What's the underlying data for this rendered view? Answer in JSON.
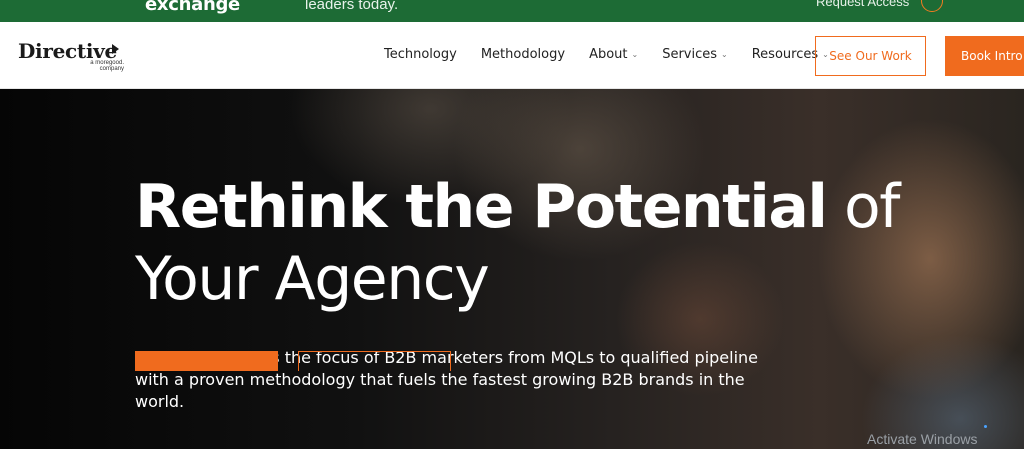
{
  "banner": {
    "brand": "exchange",
    "tagline": "leaders today.",
    "request": "Request Access"
  },
  "nav": {
    "logo": {
      "name": "Directive",
      "sub_line1": "a moregood.",
      "sub_line2": "company"
    },
    "links": [
      {
        "label": "Technology",
        "dropdown": false
      },
      {
        "label": "Methodology",
        "dropdown": false
      },
      {
        "label": "About",
        "dropdown": true
      },
      {
        "label": "Services",
        "dropdown": true
      },
      {
        "label": "Resources",
        "dropdown": true
      }
    ],
    "cta_outline": "See Our Work",
    "cta_solid": "Book Intro C"
  },
  "hero": {
    "title_bold": "Rethink the Potential",
    "title_light_1": "of",
    "title_light_2": "Your Agency",
    "description": "Directive elevates the focus of B2B marketers from MQLs to qualified pipeline with a proven methodology that fuels the fastest growing B2B brands in the world."
  },
  "overlay": {
    "activate": "Activate Windows"
  },
  "colors": {
    "accent": "#f06b1e",
    "banner": "#1d6b35"
  }
}
